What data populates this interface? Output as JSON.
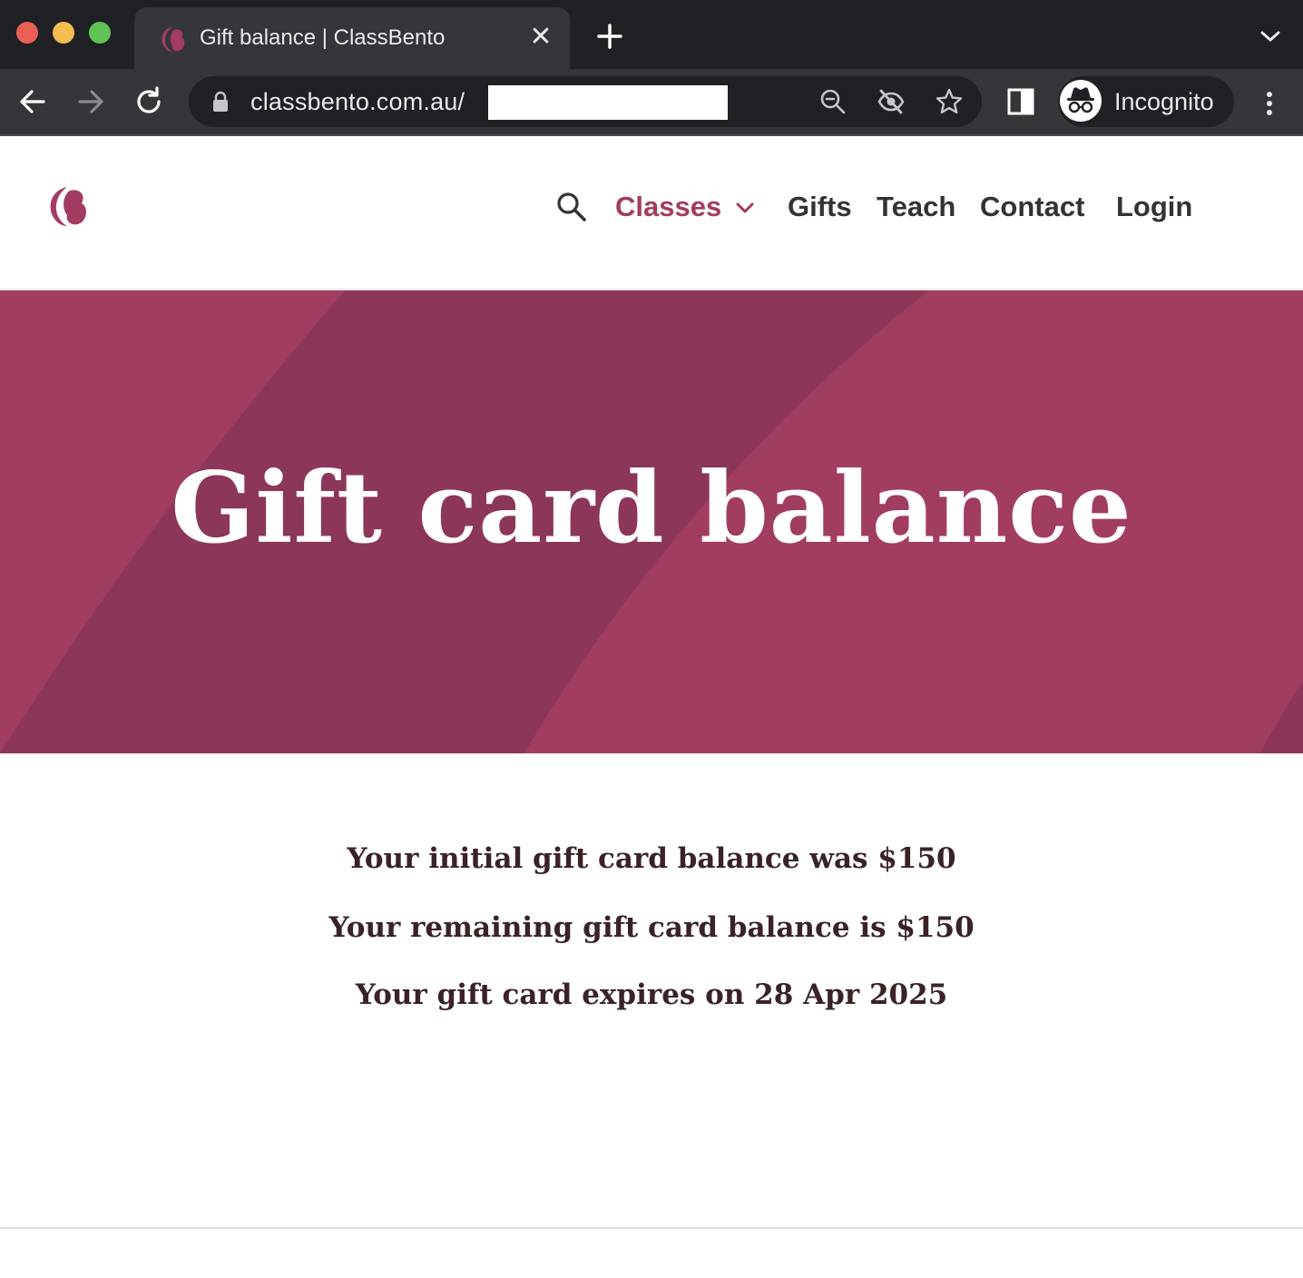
{
  "browser": {
    "tab": {
      "title": "Gift balance | ClassBento",
      "close_glyph": "✕",
      "favicon": "classbento-logo-icon"
    },
    "new_tab_icon": "plus-icon",
    "tab_menu_icon": "chevron-down-icon",
    "nav_icons": [
      "back-arrow-icon",
      "forward-arrow-icon",
      "reload-icon"
    ],
    "address_bar": {
      "url_text": "classbento.com.au/",
      "lock_icon": "lock-icon",
      "right_icons": [
        "zoom-out-icon",
        "eye-off-icon",
        "star-icon"
      ]
    },
    "side_panel_icon": "side-panel-icon",
    "profile": {
      "label": "Incognito",
      "icon": "incognito-icon"
    },
    "menu_icon": "kebab-menu-icon"
  },
  "site": {
    "brand_color": "#a23c62",
    "logo": "classbento-logo-icon",
    "nav": {
      "search_icon": "search-icon",
      "classes": "Classes",
      "gifts": "Gifts",
      "teach": "Teach",
      "contact": "Contact",
      "login": "Login"
    }
  },
  "hero": {
    "title": "Gift card balance",
    "bg_color": "#a23d62",
    "stripe_color": "#8c3759"
  },
  "balance": {
    "initial": "Your initial gift card balance was $150",
    "remaining": "Your remaining gift card balance is $150",
    "expiry": "Your gift card expires on 28 Apr 2025"
  }
}
